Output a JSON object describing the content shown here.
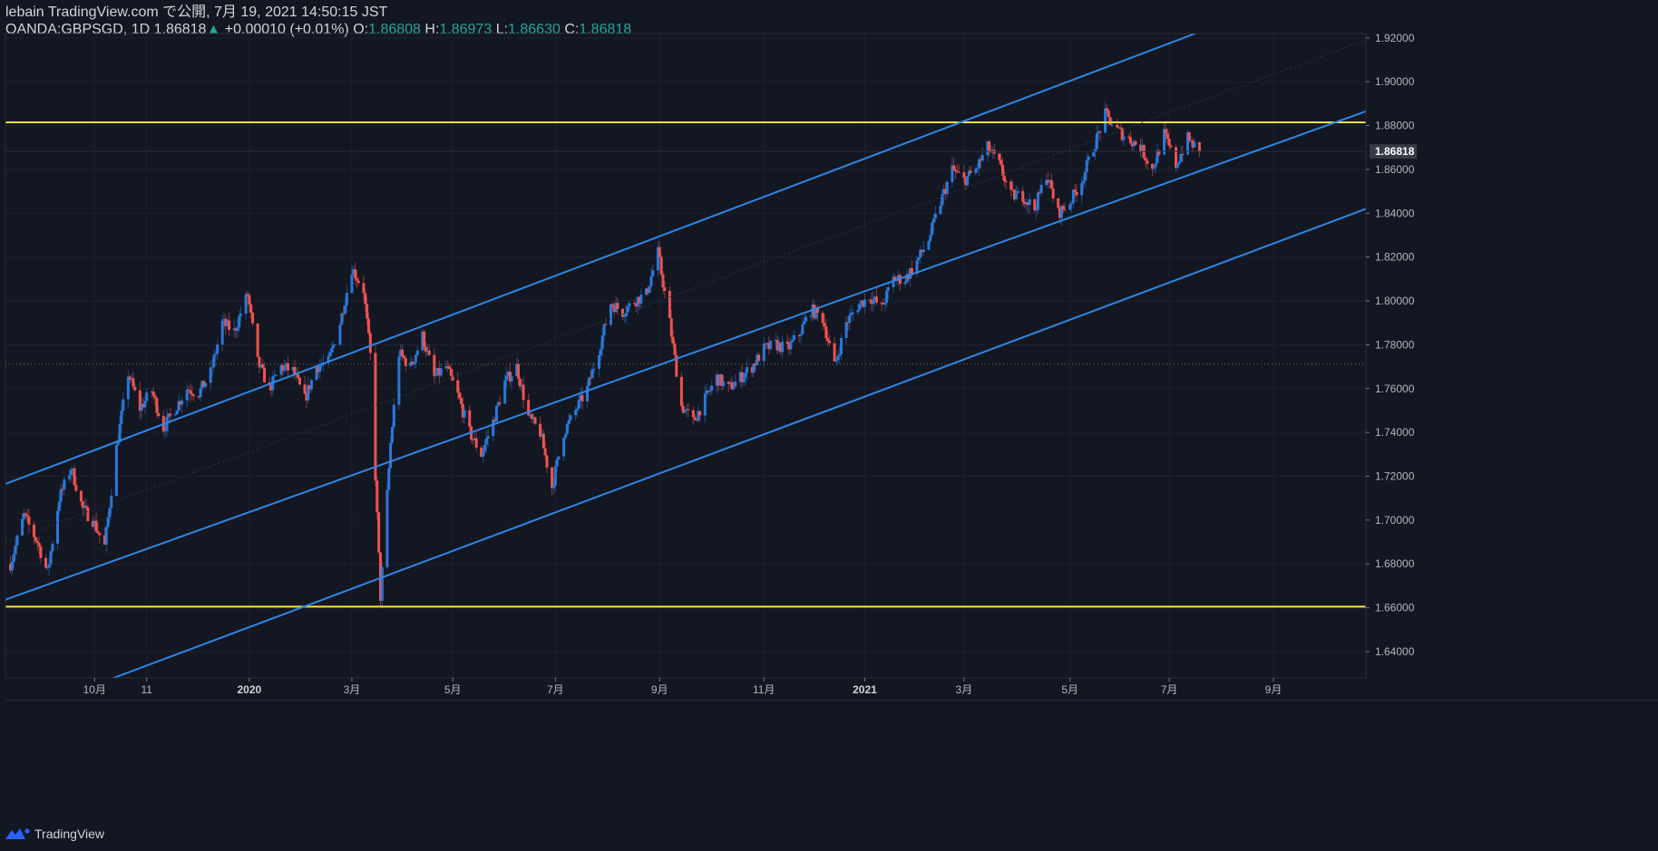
{
  "header": {
    "published": "lebain TradingView.com で公開, 7月 19, 2021 14:50:15 JST",
    "symbol": "OANDA:GBPSGD, 1D",
    "last": "1.86818",
    "change_arrow": "▲",
    "change": "+0.00010 (+0.01%)",
    "o_label": "O:",
    "o_value": "1.86808",
    "h_label": "H:",
    "h_value": "1.86973",
    "l_label": "L:",
    "l_value": "1.86630",
    "c_label": "C:",
    "c_value": "1.86818"
  },
  "footer": {
    "brand": "TradingView"
  },
  "colors": {
    "background": "#131722",
    "up": "#2979d9",
    "down": "#ef5350",
    "channel": "#2f86e6",
    "horizontal": "#f5e13b",
    "price_label_bg": "#363a45",
    "axis_text": "#b2b5be"
  },
  "chart_data": {
    "type": "candlestick",
    "symbol": "OANDA:GBPSGD",
    "interval": "1D",
    "y_axis": {
      "range": [
        1.628,
        1.922
      ],
      "ticks": [
        "1.92000",
        "1.90000",
        "1.88000",
        "1.86000",
        "1.84000",
        "1.82000",
        "1.80000",
        "1.78000",
        "1.76000",
        "1.74000",
        "1.72000",
        "1.70000",
        "1.68000",
        "1.66000",
        "1.64000"
      ],
      "tick_values": [
        1.92,
        1.9,
        1.88,
        1.86,
        1.84,
        1.82,
        1.8,
        1.78,
        1.76,
        1.74,
        1.72,
        1.7,
        1.68,
        1.66,
        1.64
      ]
    },
    "x_axis": {
      "range": [
        "2019-08-09",
        "2021-10-26"
      ],
      "ticks": [
        {
          "label": "10月",
          "date": "2019-10-01"
        },
        {
          "label": "11",
          "date": "2019-11-01"
        },
        {
          "label": "2020",
          "date": "2020-01-01"
        },
        {
          "label": "3月",
          "date": "2020-03-02"
        },
        {
          "label": "5月",
          "date": "2020-05-01"
        },
        {
          "label": "7月",
          "date": "2020-07-01"
        },
        {
          "label": "9月",
          "date": "2020-09-01"
        },
        {
          "label": "11月",
          "date": "2020-11-02"
        },
        {
          "label": "2021",
          "date": "2021-01-01"
        },
        {
          "label": "3月",
          "date": "2021-03-01"
        },
        {
          "label": "5月",
          "date": "2021-05-03"
        },
        {
          "label": "7月",
          "date": "2021-07-01"
        },
        {
          "label": "9月",
          "date": "2021-09-01"
        }
      ]
    },
    "last_price": 1.86818,
    "last_price_label": "1.86818",
    "horizontal_lines": [
      1.8815,
      1.6605
    ],
    "dotted_level": 1.7712,
    "channels": [
      {
        "name": "upper",
        "p1": {
          "date": "2019-08-09",
          "price": 1.7165
        },
        "p2": {
          "date": "2021-10-26",
          "price": 1.9515
        }
      },
      {
        "name": "middle",
        "p1": {
          "date": "2019-08-09",
          "price": 1.6637
        },
        "p2": {
          "date": "2021-10-26",
          "price": 1.8865
        }
      },
      {
        "name": "lower",
        "p1": {
          "date": "2019-08-09",
          "price": 1.6095
        },
        "p2": {
          "date": "2021-10-26",
          "price": 1.842
        }
      }
    ],
    "midlines": [
      {
        "p1": {
          "date": "2019-08-09",
          "price": 1.69
        },
        "p2": {
          "date": "2021-10-26",
          "price": 1.919
        }
      }
    ],
    "price_path": [
      [
        "2019-08-12",
        1.68
      ],
      [
        "2019-08-20",
        1.702
      ],
      [
        "2019-08-28",
        1.69
      ],
      [
        "2019-09-03",
        1.676
      ],
      [
        "2019-09-10",
        1.71
      ],
      [
        "2019-09-17",
        1.724
      ],
      [
        "2019-09-24",
        1.705
      ],
      [
        "2019-09-30",
        1.7
      ],
      [
        "2019-10-07",
        1.688
      ],
      [
        "2019-10-14",
        1.733
      ],
      [
        "2019-10-21",
        1.767
      ],
      [
        "2019-10-28",
        1.751
      ],
      [
        "2019-11-04",
        1.759
      ],
      [
        "2019-11-11",
        1.742
      ],
      [
        "2019-11-18",
        1.751
      ],
      [
        "2019-11-25",
        1.76
      ],
      [
        "2019-12-02",
        1.758
      ],
      [
        "2019-12-09",
        1.767
      ],
      [
        "2019-12-16",
        1.79
      ],
      [
        "2019-12-23",
        1.786
      ],
      [
        "2019-12-31",
        1.803
      ],
      [
        "2020-01-06",
        1.772
      ],
      [
        "2020-01-13",
        1.76
      ],
      [
        "2020-01-20",
        1.77
      ],
      [
        "2020-01-27",
        1.768
      ],
      [
        "2020-02-03",
        1.755
      ],
      [
        "2020-02-10",
        1.77
      ],
      [
        "2020-02-17",
        1.772
      ],
      [
        "2020-02-24",
        1.79
      ],
      [
        "2020-03-02",
        1.815
      ],
      [
        "2020-03-09",
        1.805
      ],
      [
        "2020-03-13",
        1.775
      ],
      [
        "2020-03-19",
        1.665
      ],
      [
        "2020-03-25",
        1.735
      ],
      [
        "2020-03-30",
        1.776
      ],
      [
        "2020-04-06",
        1.77
      ],
      [
        "2020-04-13",
        1.784
      ],
      [
        "2020-04-20",
        1.765
      ],
      [
        "2020-04-27",
        1.77
      ],
      [
        "2020-05-04",
        1.757
      ],
      [
        "2020-05-11",
        1.74
      ],
      [
        "2020-05-18",
        1.73
      ],
      [
        "2020-05-25",
        1.745
      ],
      [
        "2020-06-01",
        1.763
      ],
      [
        "2020-06-08",
        1.77
      ],
      [
        "2020-06-15",
        1.747
      ],
      [
        "2020-06-22",
        1.74
      ],
      [
        "2020-06-29",
        1.715
      ],
      [
        "2020-07-06",
        1.74
      ],
      [
        "2020-07-13",
        1.75
      ],
      [
        "2020-07-20",
        1.76
      ],
      [
        "2020-07-27",
        1.778
      ],
      [
        "2020-08-03",
        1.799
      ],
      [
        "2020-08-10",
        1.795
      ],
      [
        "2020-08-17",
        1.8
      ],
      [
        "2020-08-24",
        1.803
      ],
      [
        "2020-08-31",
        1.822
      ],
      [
        "2020-09-07",
        1.79
      ],
      [
        "2020-09-14",
        1.752
      ],
      [
        "2020-09-21",
        1.745
      ],
      [
        "2020-09-28",
        1.755
      ],
      [
        "2020-10-05",
        1.765
      ],
      [
        "2020-10-12",
        1.76
      ],
      [
        "2020-10-19",
        1.765
      ],
      [
        "2020-10-26",
        1.77
      ],
      [
        "2020-11-02",
        1.778
      ],
      [
        "2020-11-09",
        1.78
      ],
      [
        "2020-11-16",
        1.778
      ],
      [
        "2020-11-23",
        1.785
      ],
      [
        "2020-11-30",
        1.796
      ],
      [
        "2020-12-07",
        1.792
      ],
      [
        "2020-12-14",
        1.77
      ],
      [
        "2020-12-21",
        1.79
      ],
      [
        "2020-12-28",
        1.798
      ],
      [
        "2021-01-04",
        1.802
      ],
      [
        "2021-01-11",
        1.797
      ],
      [
        "2021-01-18",
        1.81
      ],
      [
        "2021-01-25",
        1.81
      ],
      [
        "2021-02-01",
        1.818
      ],
      [
        "2021-02-08",
        1.828
      ],
      [
        "2021-02-15",
        1.845
      ],
      [
        "2021-02-22",
        1.86
      ],
      [
        "2021-03-01",
        1.855
      ],
      [
        "2021-03-08",
        1.86
      ],
      [
        "2021-03-15",
        1.87
      ],
      [
        "2021-03-22",
        1.862
      ],
      [
        "2021-03-29",
        1.848
      ],
      [
        "2021-04-05",
        1.848
      ],
      [
        "2021-04-12",
        1.842
      ],
      [
        "2021-04-19",
        1.858
      ],
      [
        "2021-04-26",
        1.84
      ],
      [
        "2021-05-03",
        1.845
      ],
      [
        "2021-05-10",
        1.855
      ],
      [
        "2021-05-17",
        1.87
      ],
      [
        "2021-05-24",
        1.885
      ],
      [
        "2021-05-31",
        1.878
      ],
      [
        "2021-06-07",
        1.874
      ],
      [
        "2021-06-14",
        1.87
      ],
      [
        "2021-06-21",
        1.86
      ],
      [
        "2021-06-28",
        1.876
      ],
      [
        "2021-07-05",
        1.862
      ],
      [
        "2021-07-12",
        1.874
      ],
      [
        "2021-07-19",
        1.868
      ]
    ]
  }
}
